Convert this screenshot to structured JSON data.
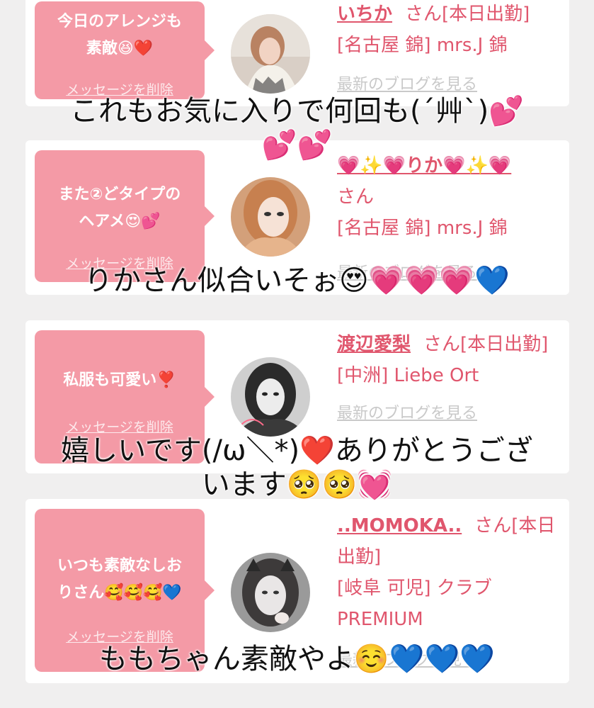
{
  "colors": {
    "accent": "#e0566d",
    "bubble": "#f49aa6",
    "background": "#f0efef"
  },
  "favorites": [
    {
      "message": "今日のアレンジも\n素敵😆❤️",
      "delete_label": "メッセージを削除",
      "name": "いちか",
      "san": "さん[本日出勤]",
      "shop": "[名古屋 錦] mrs.J 錦",
      "blog_link": "最新のブログを見る",
      "avatar_icon": "profile-photo"
    },
    {
      "message": "また②どタイプの\nヘアメ😍💕",
      "delete_label": "メッセージを削除",
      "name": "💗✨💗りか💗✨💗",
      "san": "さん",
      "shop": "[名古屋 錦] mrs.J 錦",
      "blog_link": "最新のブログを見る",
      "avatar_icon": "profile-photo"
    },
    {
      "message": "私服も可愛い❣️",
      "delete_label": "メッセージを削除",
      "name": "渡辺愛梨",
      "san": "さん[本日出勤]",
      "shop": "[中洲] Liebe Ort",
      "blog_link": "最新のブログを見る",
      "avatar_icon": "profile-photo"
    },
    {
      "message": "いつも素敵なしお\nりさん🥰🥰🥰💙",
      "delete_label": "メッセージを削除",
      "name": "..MOMOKA..",
      "san": "さん[本日出勤]",
      "shop": "[岐阜 可児] クラブ PREMIUM",
      "blog_link": "最新のブログを見る",
      "avatar_icon": "profile-photo"
    }
  ],
  "comments": [
    "これもお気に入りで何回も(´艸`)💕\n💕💕",
    "りかさん似合いそぉ😍💗💗💗💙",
    "嬉しいです(/ω＼*)❤️ありがとうござ\nいます🥺🥺💓",
    "ももちゃん素敵やよ☺️💙💙💙"
  ]
}
